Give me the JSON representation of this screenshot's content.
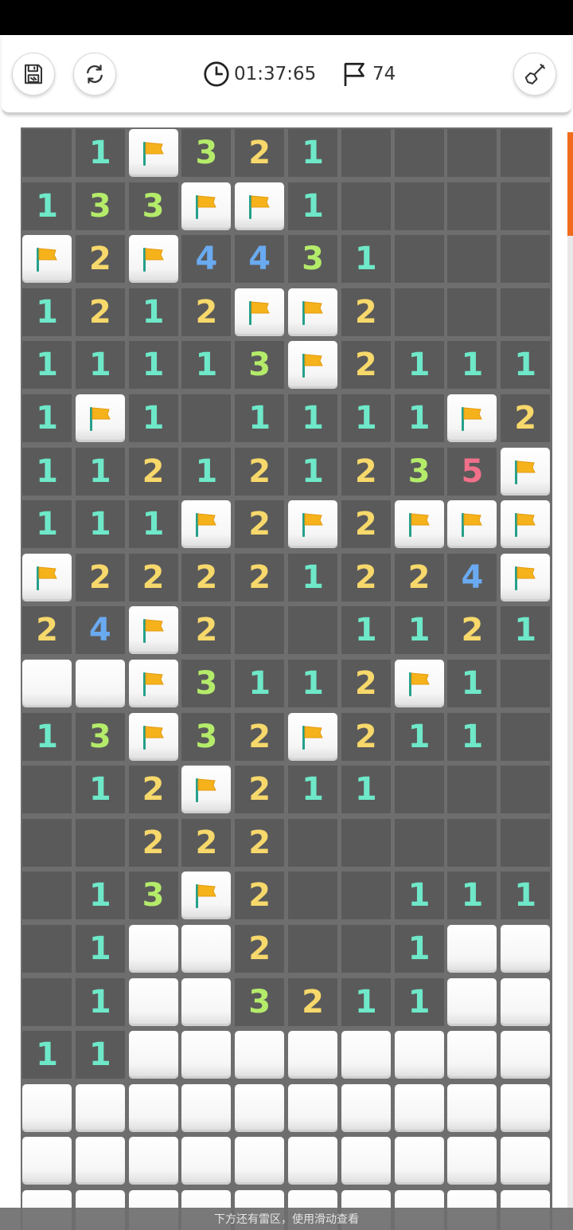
{
  "toolbar": {
    "timer": "01:37:65",
    "flags_remaining": "74",
    "save_icon": "floppy-disk-icon",
    "restart_icon": "refresh-icon",
    "timer_icon": "clock-icon",
    "flag_icon": "flag-outline-icon",
    "dig_icon": "shovel-icon"
  },
  "board": {
    "columns": 10,
    "legend": {
      "o": "opened empty",
      "h": "unopened",
      "F": "flagged",
      "1-8": "opened number"
    },
    "rows": [
      [
        "o",
        "1",
        "F",
        "3",
        "2",
        "1",
        "o",
        "o",
        "o",
        "o"
      ],
      [
        "1",
        "3",
        "3",
        "F",
        "F",
        "1",
        "o",
        "o",
        "o",
        "o"
      ],
      [
        "F",
        "2",
        "F",
        "4",
        "4",
        "3",
        "1",
        "o",
        "o",
        "o"
      ],
      [
        "1",
        "2",
        "1",
        "2",
        "F",
        "F",
        "2",
        "o",
        "o",
        "o"
      ],
      [
        "1",
        "1",
        "1",
        "1",
        "3",
        "F",
        "2",
        "1",
        "1",
        "1"
      ],
      [
        "1",
        "F",
        "1",
        "o",
        "1",
        "1",
        "1",
        "1",
        "F",
        "2"
      ],
      [
        "1",
        "1",
        "2",
        "1",
        "2",
        "1",
        "2",
        "3",
        "5",
        "F"
      ],
      [
        "1",
        "1",
        "1",
        "F",
        "2",
        "F",
        "2",
        "F",
        "F",
        "F"
      ],
      [
        "F",
        "2",
        "2",
        "2",
        "2",
        "1",
        "2",
        "2",
        "4",
        "F"
      ],
      [
        "2",
        "4",
        "F",
        "2",
        "o",
        "o",
        "1",
        "1",
        "2",
        "1"
      ],
      [
        "h",
        "h",
        "F",
        "3",
        "1",
        "1",
        "2",
        "F",
        "1",
        "o"
      ],
      [
        "1",
        "3",
        "F",
        "3",
        "2",
        "F",
        "2",
        "1",
        "1",
        "o"
      ],
      [
        "o",
        "1",
        "2",
        "F",
        "2",
        "1",
        "1",
        "o",
        "o",
        "o"
      ],
      [
        "o",
        "o",
        "2",
        "2",
        "2",
        "o",
        "o",
        "o",
        "o",
        "o"
      ],
      [
        "o",
        "1",
        "3",
        "F",
        "2",
        "o",
        "o",
        "1",
        "1",
        "1"
      ],
      [
        "o",
        "1",
        "h",
        "h",
        "2",
        "o",
        "o",
        "1",
        "h",
        "h"
      ],
      [
        "o",
        "1",
        "h",
        "h",
        "3",
        "2",
        "1",
        "1",
        "h",
        "h"
      ],
      [
        "1",
        "1",
        "h",
        "h",
        "h",
        "h",
        "h",
        "h",
        "h",
        "h"
      ],
      [
        "h",
        "h",
        "h",
        "h",
        "h",
        "h",
        "h",
        "h",
        "h",
        "h"
      ],
      [
        "h",
        "h",
        "h",
        "h",
        "h",
        "h",
        "h",
        "h",
        "h",
        "h"
      ],
      [
        "h",
        "h",
        "h",
        "h",
        "h",
        "h",
        "h",
        "h",
        "h",
        "h"
      ]
    ]
  },
  "colors": {
    "n1": "#6ee8c8",
    "n2": "#f7d86b",
    "n3": "#b4ec6a",
    "n4": "#6aaaf0",
    "n5": "#f0708a",
    "flag": "#f6b21a",
    "pole": "#26a08a",
    "accent": "#f26b1d"
  },
  "hint": "下方还有雷区，使用滑动查看"
}
